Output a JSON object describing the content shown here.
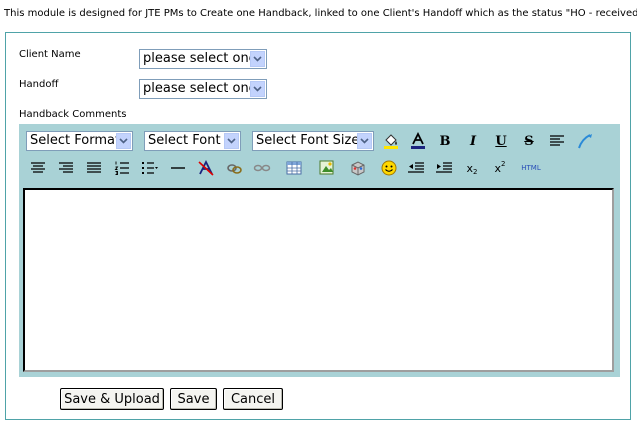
{
  "intro_text": "This module is designed for JTE PMs to Create one Handback, linked to one Client's Handoff which as the status \"HO - received\".",
  "form": {
    "client_name_label": "Client Name",
    "client_name_value": "please select one",
    "handoff_label": "Handoff",
    "handoff_value": "please select one",
    "comments_label": "Handback Comments"
  },
  "editor": {
    "format_value": "Select Format",
    "font_value": "Select Font",
    "font_size_value": "Select Font Size",
    "toolbar_row1_icons": [
      "fill-color-icon",
      "font-color-icon",
      "bold-icon",
      "italic-icon",
      "underline-icon",
      "strikethrough-icon",
      "align-left-icon",
      "cleanup-icon"
    ],
    "bold_glyph": "B",
    "italic_glyph": "I",
    "underline_glyph": "U",
    "strike_glyph": "S",
    "html_label": "HTML",
    "subscript_glyph": "x",
    "superscript_glyph": "x",
    "subscript_mark": "2",
    "superscript_mark": "2",
    "content": ""
  },
  "buttons": {
    "save_upload_label": "Save & Upload",
    "save_label": "Save",
    "cancel_label": "Cancel"
  },
  "colors": {
    "panel_border": "#4fa3a8",
    "editor_background": "#a9d2d6"
  }
}
